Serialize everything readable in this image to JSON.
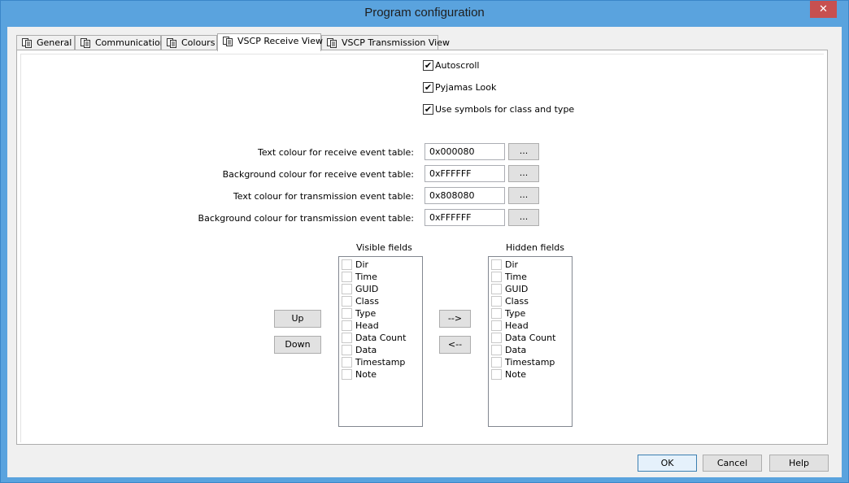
{
  "window": {
    "title": "Program configuration",
    "close_glyph": "✕"
  },
  "tabs": [
    {
      "label": "General",
      "icon": "copy-pages-icon"
    },
    {
      "label": "Communication",
      "icon": "copy-pages-icon"
    },
    {
      "label": "Colours",
      "icon": "copy-pages-icon"
    },
    {
      "label": "VSCP Receive View",
      "icon": "copy-pages-icon",
      "active": true
    },
    {
      "label": "VSCP Transmission View",
      "icon": "copy-pages-icon"
    }
  ],
  "options": {
    "autoscroll": {
      "label": "Autoscroll",
      "checked": true
    },
    "pyjamas": {
      "label": "Pyjamas Look",
      "checked": true
    },
    "symbols": {
      "label": "Use symbols for class and type",
      "checked": true
    }
  },
  "colours": [
    {
      "label": "Text colour for receive event table:",
      "value": "0x000080",
      "button": "..."
    },
    {
      "label": "Background colour for receive event table:",
      "value": "0xFFFFFF",
      "button": "..."
    },
    {
      "label": "Text colour for transmission event table:",
      "value": "0x808080",
      "button": "..."
    },
    {
      "label": "Background colour for transmission event table:",
      "value": "0xFFFFFF",
      "button": "..."
    }
  ],
  "fields": {
    "visible_title": "Visible fields",
    "hidden_title": "Hidden fields",
    "visible": [
      "Dir",
      "Time",
      "GUID",
      "Class",
      "Type",
      "Head",
      "Data Count",
      "Data",
      "Timestamp",
      "Note"
    ],
    "hidden": [
      "Dir",
      "Time",
      "GUID",
      "Class",
      "Type",
      "Head",
      "Data Count",
      "Data",
      "Timestamp",
      "Note"
    ],
    "up_label": "Up",
    "down_label": "Down",
    "move_right_label": "-->",
    "move_left_label": "<--"
  },
  "buttons": {
    "ok": "OK",
    "cancel": "Cancel",
    "help": "Help"
  },
  "colors": {
    "title_bar": "#5aa3de",
    "close_button": "#c75050",
    "dialog_bg": "#f0f0f0"
  }
}
